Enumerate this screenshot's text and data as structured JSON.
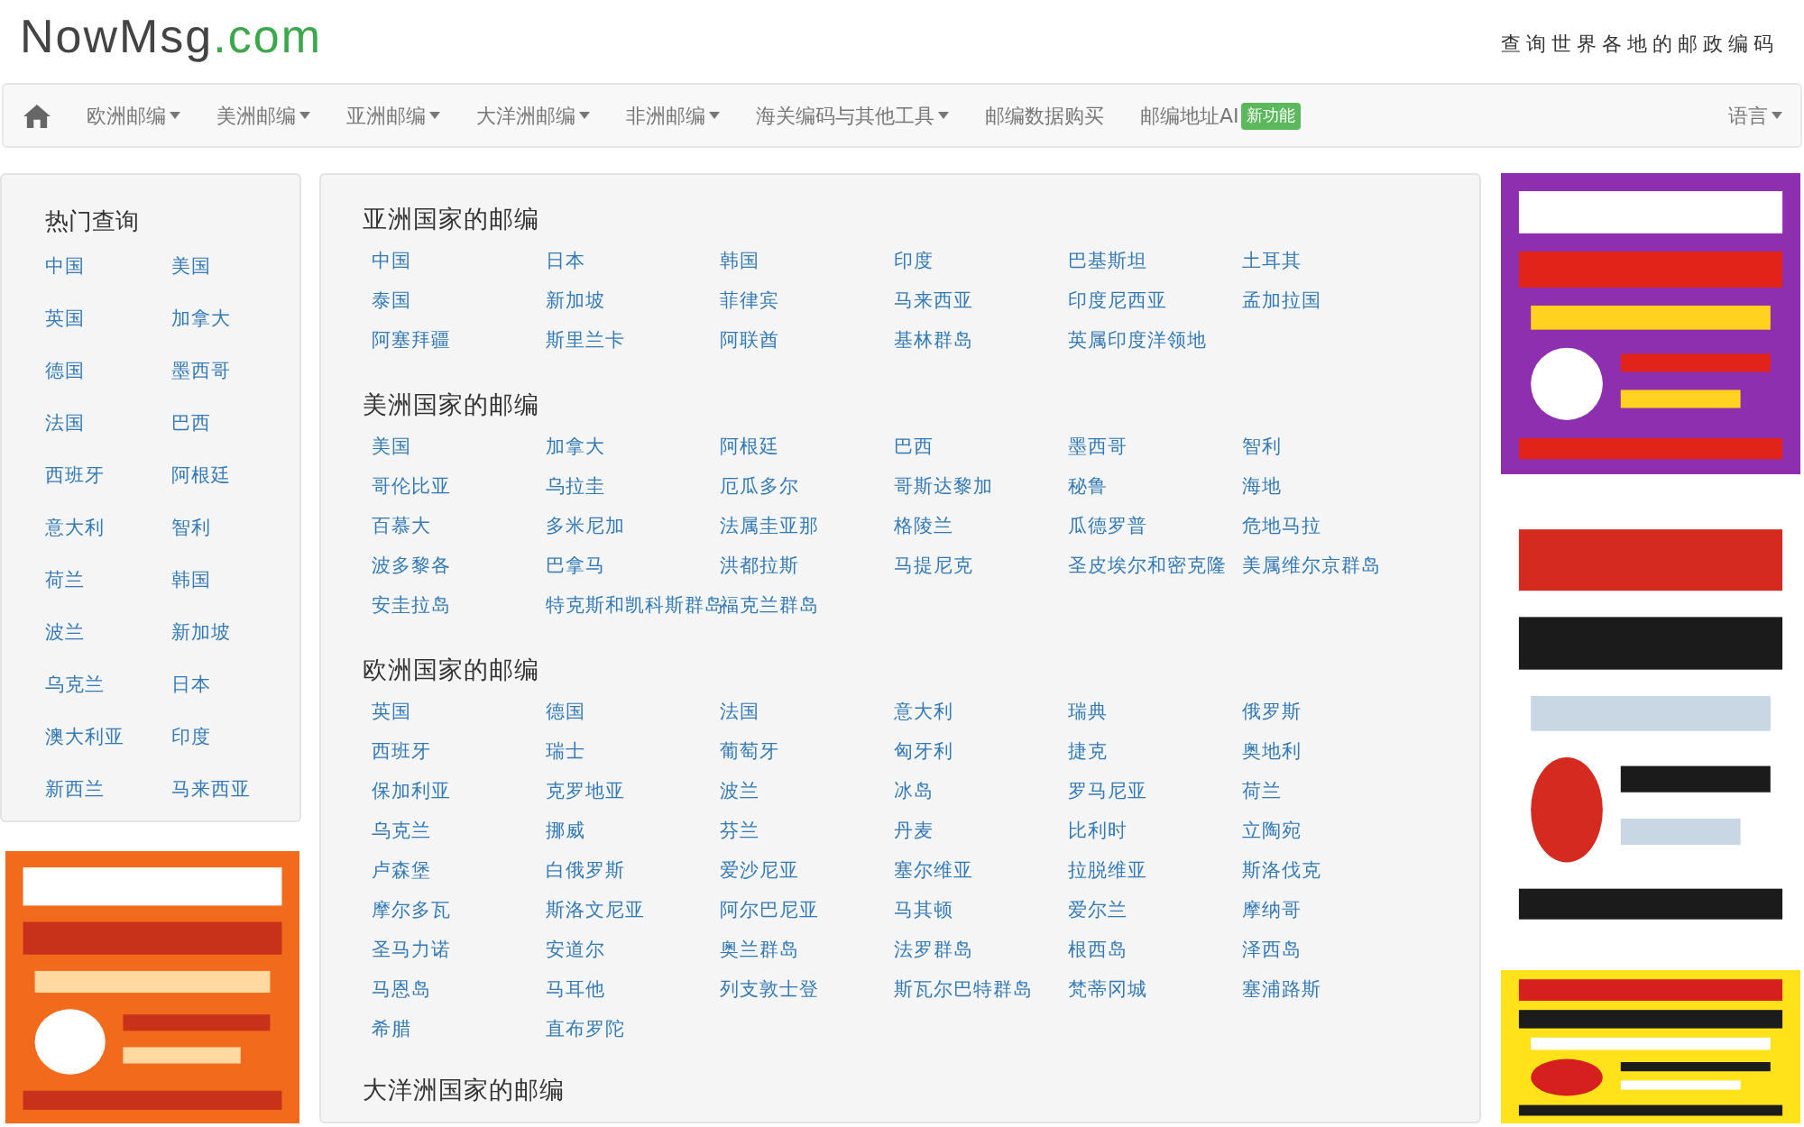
{
  "header": {
    "logo_name": "NowMsg",
    "logo_domain": ".com",
    "tagline": "查询世界各地的邮政编码"
  },
  "navbar": {
    "items": [
      {
        "label": "欧洲邮编",
        "dropdown": true
      },
      {
        "label": "美洲邮编",
        "dropdown": true
      },
      {
        "label": "亚洲邮编",
        "dropdown": true
      },
      {
        "label": "大洋洲邮编",
        "dropdown": true
      },
      {
        "label": "非洲邮编",
        "dropdown": true
      },
      {
        "label": "海关编码与其他工具",
        "dropdown": true
      },
      {
        "label": "邮编数据购买",
        "dropdown": false
      },
      {
        "label": "邮编地址AI",
        "dropdown": false,
        "badge": "新功能"
      }
    ],
    "language": {
      "label": "语言",
      "dropdown": true
    }
  },
  "sidebar": {
    "title": "热门查询",
    "items": [
      "中国",
      "美国",
      "英国",
      "加拿大",
      "德国",
      "墨西哥",
      "法国",
      "巴西",
      "西班牙",
      "阿根廷",
      "意大利",
      "智利",
      "荷兰",
      "韩国",
      "波兰",
      "新加坡",
      "乌克兰",
      "日本",
      "澳大利亚",
      "印度",
      "新西兰",
      "马来西亚"
    ]
  },
  "sections": [
    {
      "title": "亚洲国家的邮编",
      "items": [
        "中国",
        "日本",
        "韩国",
        "印度",
        "巴基斯坦",
        "土耳其",
        "泰国",
        "新加坡",
        "菲律宾",
        "马来西亚",
        "印度尼西亚",
        "孟加拉国",
        "阿塞拜疆",
        "斯里兰卡",
        "阿联酋",
        "基林群岛",
        "英属印度洋领地"
      ]
    },
    {
      "title": "美洲国家的邮编",
      "items": [
        "美国",
        "加拿大",
        "阿根廷",
        "巴西",
        "墨西哥",
        "智利",
        "哥伦比亚",
        "乌拉圭",
        "厄瓜多尔",
        "哥斯达黎加",
        "秘鲁",
        "海地",
        "百慕大",
        "多米尼加",
        "法属圭亚那",
        "格陵兰",
        "瓜德罗普",
        "危地马拉",
        "波多黎各",
        "巴拿马",
        "洪都拉斯",
        "马提尼克",
        "圣皮埃尔和密克隆",
        "美属维尔京群岛",
        "安圭拉岛",
        "特克斯和凯科斯群岛",
        "福克兰群岛"
      ]
    },
    {
      "title": "欧洲国家的邮编",
      "items": [
        "英国",
        "德国",
        "法国",
        "意大利",
        "瑞典",
        "俄罗斯",
        "西班牙",
        "瑞士",
        "葡萄牙",
        "匈牙利",
        "捷克",
        "奥地利",
        "保加利亚",
        "克罗地亚",
        "波兰",
        "冰岛",
        "罗马尼亚",
        "荷兰",
        "乌克兰",
        "挪威",
        "芬兰",
        "丹麦",
        "比利时",
        "立陶宛",
        "卢森堡",
        "白俄罗斯",
        "爱沙尼亚",
        "塞尔维亚",
        "拉脱维亚",
        "斯洛伐克",
        "摩尔多瓦",
        "斯洛文尼亚",
        "阿尔巴尼亚",
        "马其顿",
        "爱尔兰",
        "摩纳哥",
        "圣马力诺",
        "安道尔",
        "奥兰群岛",
        "法罗群岛",
        "根西岛",
        "泽西岛",
        "马恩岛",
        "马耳他",
        "列支敦士登",
        "斯瓦尔巴特群岛",
        "梵蒂冈城",
        "塞浦路斯",
        "希腊",
        "直布罗陀"
      ]
    },
    {
      "title": "大洋洲国家的邮编"
    }
  ]
}
